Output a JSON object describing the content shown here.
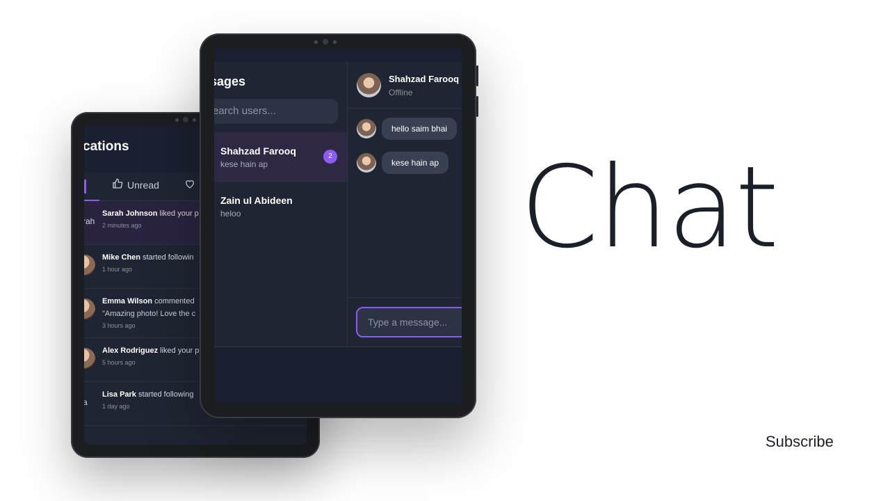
{
  "notifications_screen": {
    "title": "cations",
    "tabs": [
      {
        "label": "Unread",
        "icon": "thumbs-up-icon"
      },
      {
        "label": "",
        "icon": "heart-icon"
      }
    ],
    "items": [
      {
        "avatar_text": "rah",
        "name": "Sarah Johnson",
        "action": "liked your p",
        "time": "2 minutes ago",
        "unread": true
      },
      {
        "avatar_text": "",
        "name": "Mike Chen",
        "action": "started followin",
        "time": "1 hour ago"
      },
      {
        "avatar_text": "",
        "name": "Emma Wilson",
        "action": "commented",
        "quote": "\"Amazing photo! Love the c",
        "time": "3 hours ago"
      },
      {
        "avatar_text": "",
        "name": "Alex Rodriguez",
        "action": "liked your p",
        "time": "5 hours ago"
      },
      {
        "avatar_text": "a",
        "name": "Lisa Park",
        "action": "started following",
        "time": "1 day ago"
      }
    ]
  },
  "messages_screen": {
    "title": "sages",
    "search_placeholder": "earch users...",
    "conversations": [
      {
        "name": "Shahzad Farooq",
        "preview": "kese hain ap",
        "badge": "2",
        "active": true
      },
      {
        "name": "Zain ul Abideen",
        "preview": "heloo",
        "badge": "",
        "active": false
      }
    ],
    "chat": {
      "contact_name": "Shahzad Farooq",
      "status": "Offline",
      "messages": [
        "hello saim bhai",
        "kese hain ap"
      ],
      "input_placeholder": "Type a message..."
    }
  },
  "hero": {
    "title": "Chat",
    "cta": "Subscribe"
  },
  "colors": {
    "accent": "#8b5cf6",
    "screen_bg": "#1f2532",
    "text_dark": "#1b1f27"
  }
}
